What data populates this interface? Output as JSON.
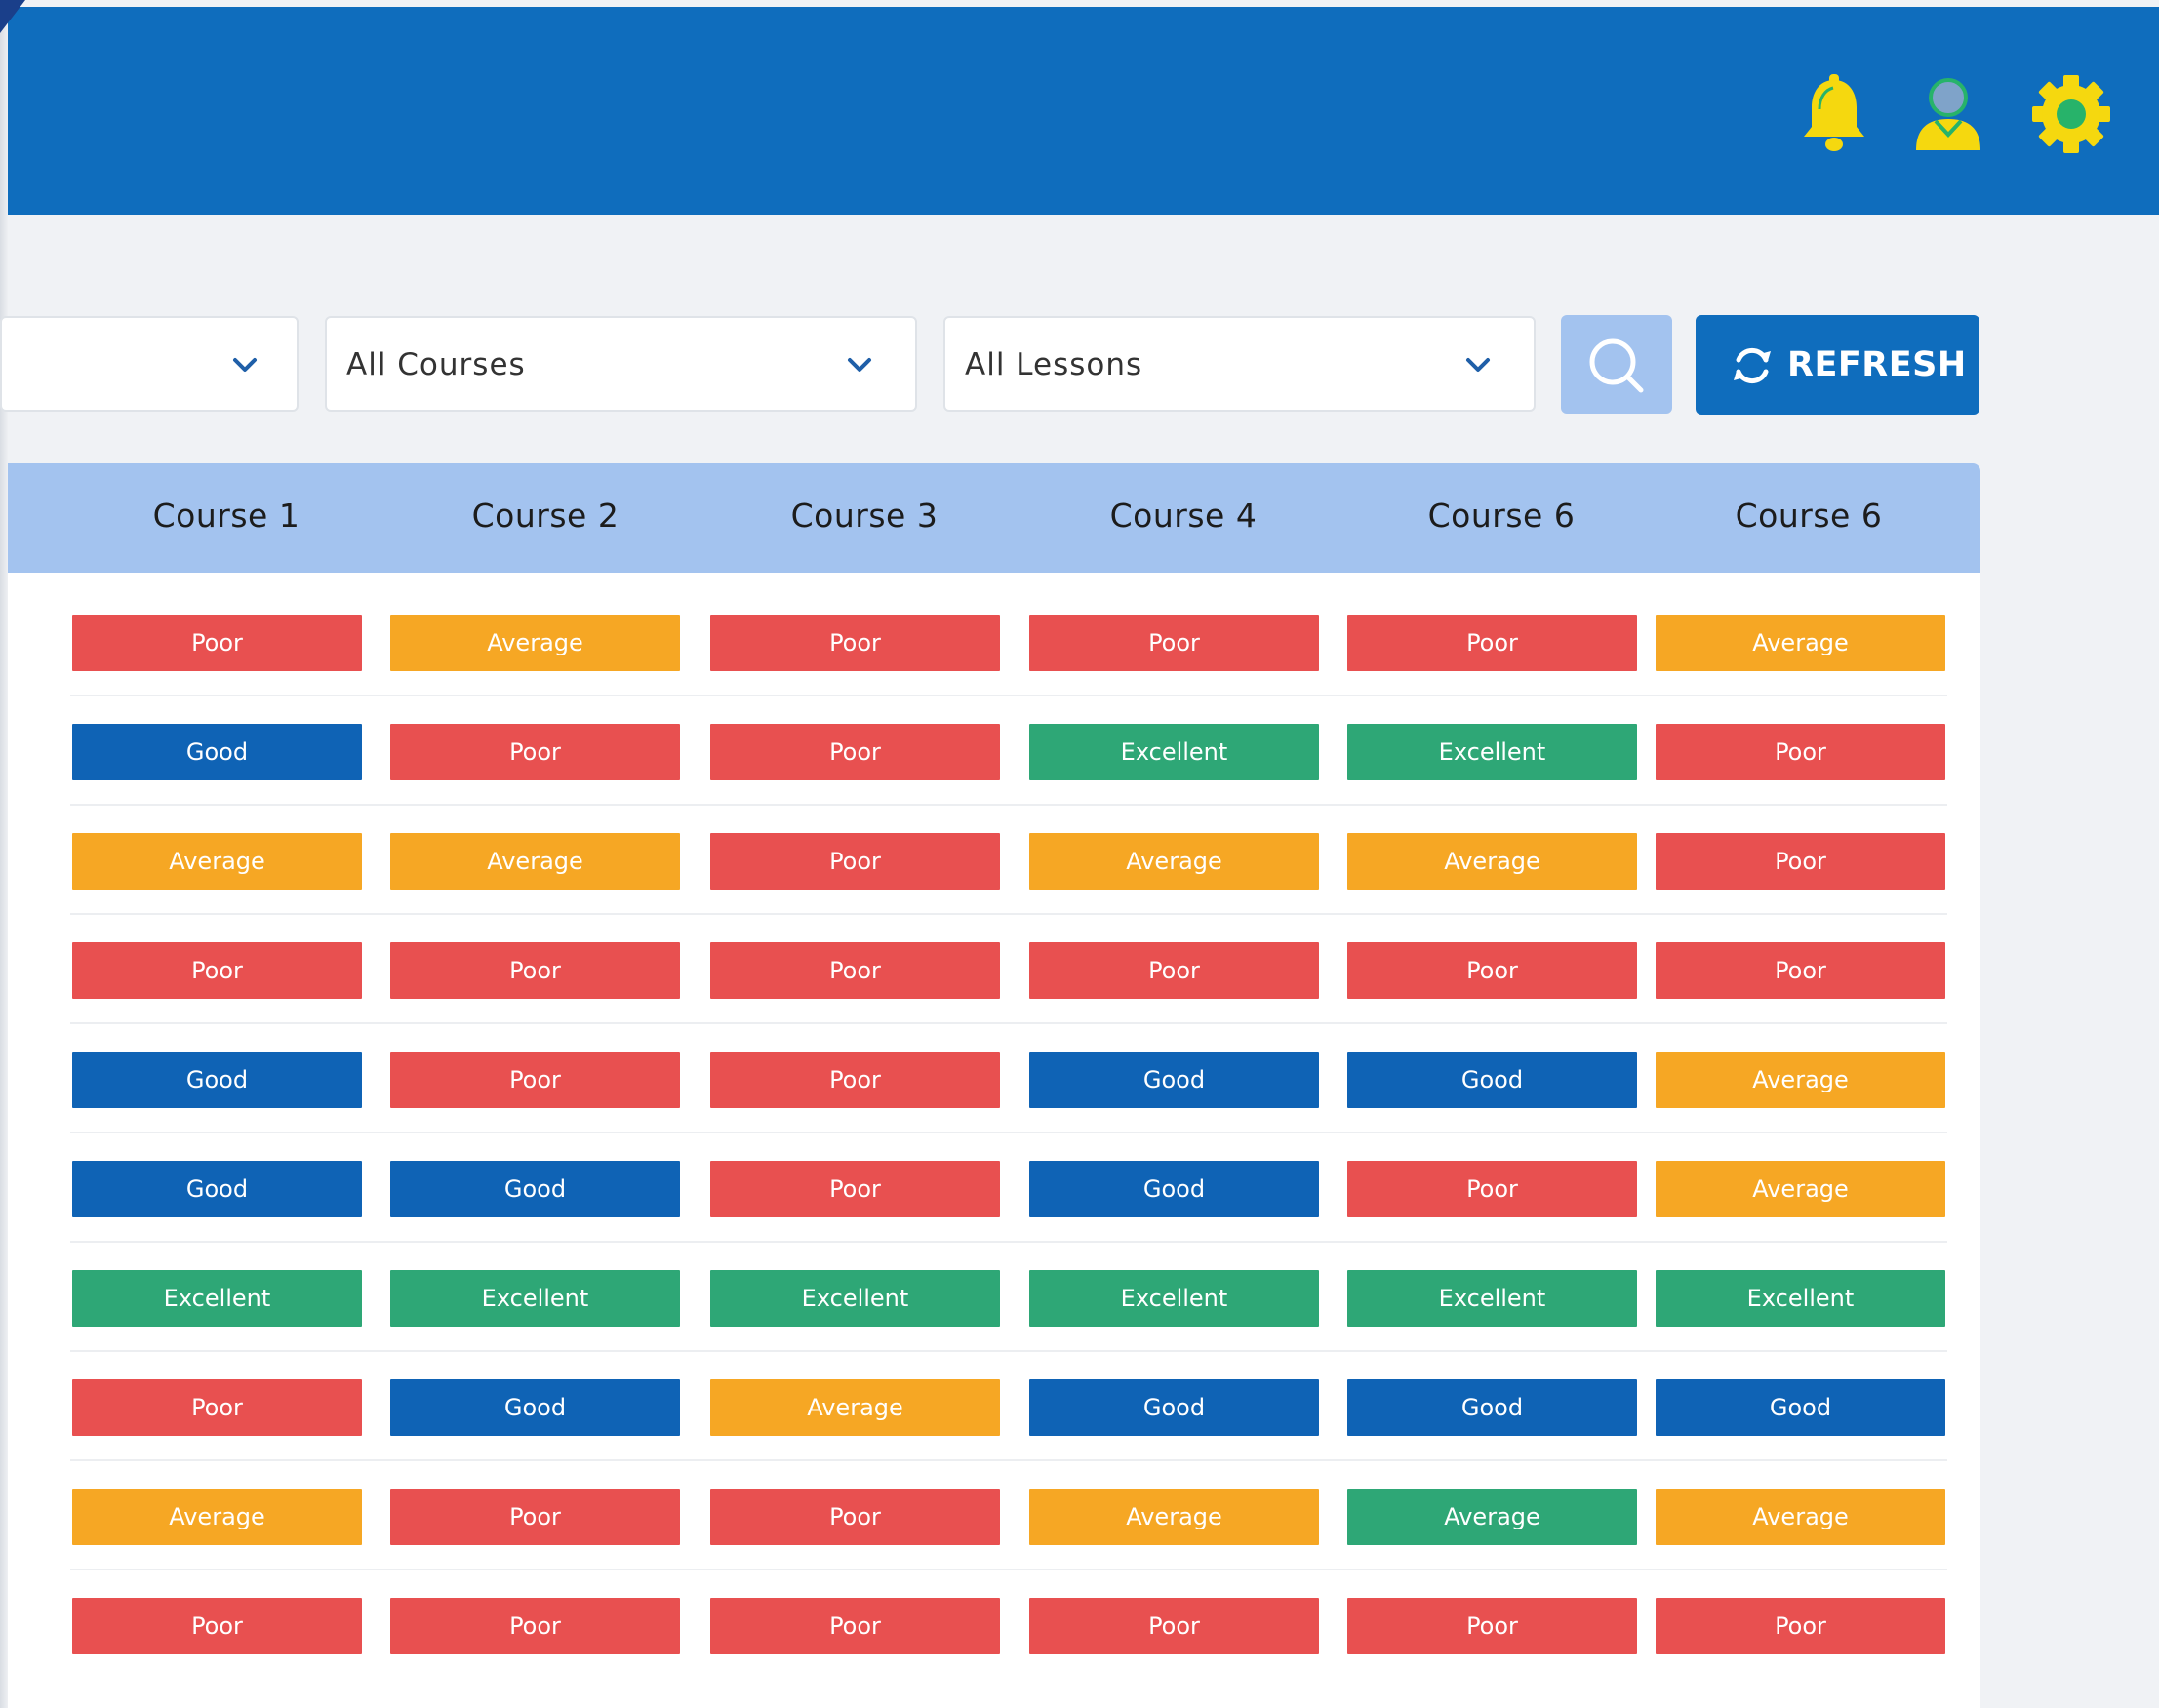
{
  "colors": {
    "header_blue": "#0f6dbd",
    "table_header": "#a3c3ef",
    "poor": "#e85050",
    "average": "#f6a724",
    "good": "#0f63b5",
    "excellent": "#2ea776"
  },
  "header": {
    "icons": [
      "bell-icon",
      "user-icon",
      "gear-icon"
    ]
  },
  "filters": {
    "first": {
      "value": ""
    },
    "courses": {
      "value": "All Courses"
    },
    "lessons": {
      "value": "All Lessons"
    },
    "search_icon": "search-icon",
    "refresh_label": "REFRESH",
    "refresh_icon": "refresh-icon"
  },
  "table": {
    "columns": [
      "Course 1",
      "Course 2",
      "Course 3",
      "Course 4",
      "Course 6",
      "Course 6"
    ],
    "rows": [
      [
        "Poor",
        "Average",
        "Poor",
        "Poor",
        "Poor",
        "Average"
      ],
      [
        "Good",
        "Poor",
        "Poor",
        "Excellent",
        "Excellent",
        "Poor"
      ],
      [
        "Average",
        "Average",
        "Poor",
        "Average",
        "Average",
        "Poor"
      ],
      [
        "Poor",
        "Poor",
        "Poor",
        "Poor",
        "Poor",
        "Poor"
      ],
      [
        "Good",
        "Poor",
        "Poor",
        "Good",
        "Good",
        "Average"
      ],
      [
        "Good",
        "Good",
        "Poor",
        "Good",
        "Poor",
        "Average"
      ],
      [
        "Excellent",
        "Excellent",
        "Excellent",
        "Excellent",
        "Excellent",
        "Excellent"
      ],
      [
        "Poor",
        "Good",
        "Average",
        "Good",
        "Good",
        "Good"
      ],
      [
        "Average",
        "Poor",
        "Poor",
        "Average",
        "Average",
        "Average"
      ],
      [
        "Poor",
        "Poor",
        "Poor",
        "Poor",
        "Poor",
        "Poor"
      ]
    ],
    "cell_styles": [
      [
        "poor",
        "average",
        "poor",
        "poor",
        "poor",
        "average"
      ],
      [
        "good",
        "poor",
        "poor",
        "excellent",
        "excellent",
        "poor"
      ],
      [
        "average",
        "average",
        "poor",
        "average",
        "average",
        "poor"
      ],
      [
        "poor",
        "poor",
        "poor",
        "poor",
        "poor",
        "poor"
      ],
      [
        "good",
        "poor",
        "poor",
        "good",
        "good",
        "average"
      ],
      [
        "good",
        "good",
        "poor",
        "good",
        "poor",
        "average"
      ],
      [
        "excellent",
        "excellent",
        "excellent",
        "excellent",
        "excellent",
        "excellent"
      ],
      [
        "poor",
        "good",
        "average",
        "good",
        "good",
        "good"
      ],
      [
        "average",
        "poor",
        "poor",
        "average",
        "excellent",
        "average"
      ],
      [
        "poor",
        "poor",
        "poor",
        "poor",
        "poor",
        "poor"
      ]
    ]
  }
}
